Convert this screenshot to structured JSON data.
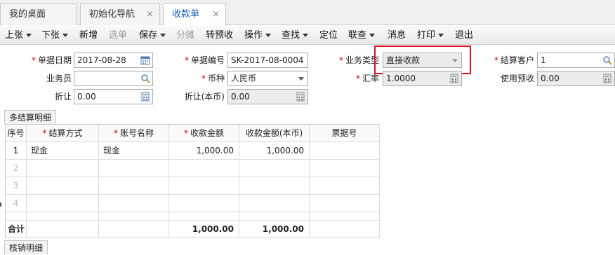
{
  "tabs": [
    {
      "label": "我的桌面",
      "closable": false,
      "active": false
    },
    {
      "label": "初始化导航",
      "closable": true,
      "active": false
    },
    {
      "label": "收款单",
      "closable": true,
      "active": true
    }
  ],
  "tab_close_glyph": "×",
  "toolbar": {
    "prev": "上张",
    "next": "下张",
    "new": "新增",
    "select": "选单",
    "save": "保存",
    "allocate": "分摊",
    "convert_prepay": "转预收",
    "operate": "操作",
    "find": "查找",
    "locate": "定位",
    "link": "联查",
    "message": "消息",
    "print": "打印",
    "exit": "退出"
  },
  "form": {
    "date_label": "单据日期",
    "date_value": "2017-08-28",
    "number_label": "单据编号",
    "number_value": "SK-2017-08-0004",
    "biz_type_label": "业务类型",
    "biz_type_value": "直接收款",
    "customer_label": "结算客户",
    "customer_value": "1",
    "salesman_label": "业务员",
    "salesman_value": "",
    "currency_label": "币种",
    "currency_value": "人民币",
    "rate_label": "汇率",
    "rate_value": "1.0000",
    "use_prepay_label": "使用预收",
    "use_prepay_value": "0.00",
    "discount_label": "折让",
    "discount_value": "0.00",
    "discount_local_label": "折让(本币)",
    "discount_local_value": "0.00"
  },
  "section_tabs": {
    "settlement": "多结算明细",
    "writeoff": "核销明细"
  },
  "grid": {
    "columns": [
      "序号",
      "结算方式",
      "账号名称",
      "收款金额",
      "收款金额(本币)",
      "票据号"
    ],
    "required_columns": [
      false,
      true,
      true,
      true,
      false,
      false
    ],
    "rows": [
      {
        "no": "1",
        "method": "现金",
        "account": "现金",
        "amount": "1,000.00",
        "amount_local": "1,000.00",
        "ticket": ""
      },
      {
        "no": "2",
        "method": "",
        "account": "",
        "amount": "",
        "amount_local": "",
        "ticket": ""
      },
      {
        "no": "3",
        "method": "",
        "account": "",
        "amount": "",
        "amount_local": "",
        "ticket": ""
      },
      {
        "no": "4",
        "method": "",
        "account": "",
        "amount": "",
        "amount_local": "",
        "ticket": ""
      }
    ],
    "total": {
      "label": "合计",
      "amount": "1,000.00",
      "amount_local": "1,000.00"
    }
  },
  "colors": {
    "highlight": "#e0141e",
    "required": "#d40000",
    "active_tab_text": "#1a5fb4"
  }
}
